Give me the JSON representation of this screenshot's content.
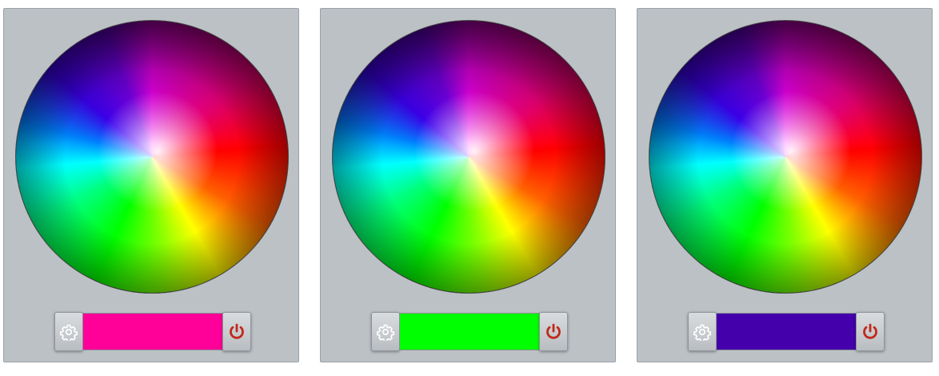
{
  "panels": [
    {
      "id": "panel-1",
      "current_color": "#ff0099",
      "settings_icon": "gear-icon",
      "power_icon": "power-icon"
    },
    {
      "id": "panel-2",
      "current_color": "#00ff00",
      "settings_icon": "gear-icon",
      "power_icon": "power-icon"
    },
    {
      "id": "panel-3",
      "current_color": "#4400aa",
      "settings_icon": "gear-icon",
      "power_icon": "power-icon"
    }
  ],
  "colors": {
    "panel_background": "#bcc1c5",
    "power_icon_color": "#c0291a",
    "gear_icon_color": "#ffffff"
  }
}
